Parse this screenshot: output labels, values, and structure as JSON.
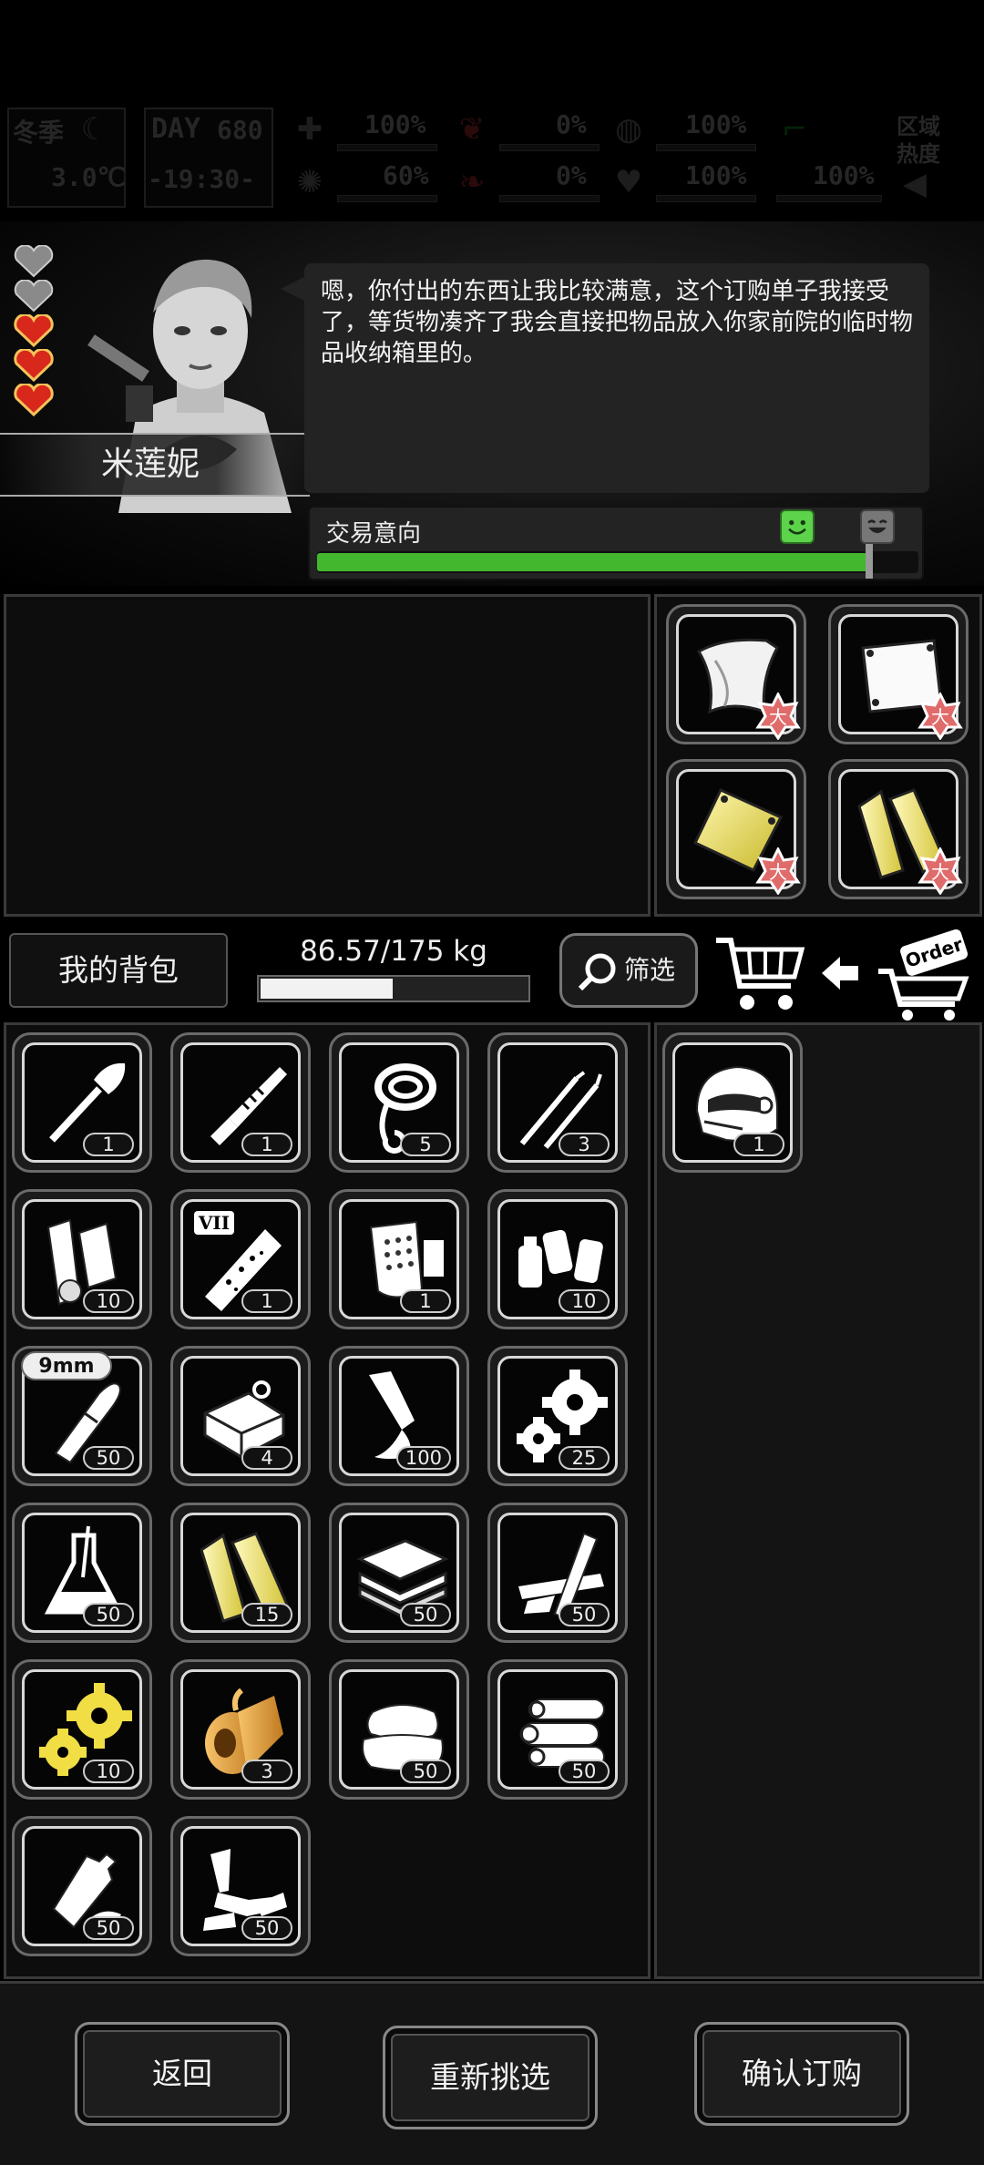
{
  "status": {
    "season": "冬季",
    "day_label": "DAY",
    "day": "680",
    "temperature": "3.0℃",
    "time": "-19:30-",
    "stats": [
      {
        "name": "health",
        "value": "100%"
      },
      {
        "name": "sanity",
        "value": "60%"
      },
      {
        "name": "bleeding",
        "value": "0%"
      },
      {
        "name": "blood",
        "value": "0%"
      },
      {
        "name": "hunger",
        "value": "100%"
      },
      {
        "name": "mood",
        "value": "100%"
      },
      {
        "name": "stamina",
        "value": "100%"
      }
    ],
    "area_label": "区域热度"
  },
  "npc": {
    "name": "米莲妮",
    "hearts_filled": 3,
    "hearts_total": 5,
    "dialog": "嗯，你付出的东西让我比较满意，这个订购单子我接受了，等货物凑齐了我会直接把物品放入你家前院的临时物品收纳箱里的。",
    "trade_label": "交易意向",
    "trade_intent": 0.92
  },
  "order_items": [
    {
      "icon": "cloth-icon",
      "size": "大"
    },
    {
      "icon": "metal-sheet-icon",
      "size": "大"
    },
    {
      "icon": "gold-plate-icon",
      "size": "大"
    },
    {
      "icon": "wood-planks-icon",
      "size": "大"
    }
  ],
  "bag": {
    "label": "我的背包",
    "weight_text": "86.57/175 kg",
    "weight_fraction": 0.495,
    "filter_label": "筛选",
    "order_badge": "Order"
  },
  "inventory": [
    {
      "icon": "shovel-icon",
      "qty": "1"
    },
    {
      "icon": "saw-knife-icon",
      "qty": "1"
    },
    {
      "icon": "rope-icon",
      "qty": "5"
    },
    {
      "icon": "lockpick-icon",
      "qty": "3"
    },
    {
      "icon": "paper-roll-icon",
      "qty": "10"
    },
    {
      "icon": "vial-icon",
      "qty": "1",
      "tag": "VII"
    },
    {
      "icon": "filter-mask-icon",
      "qty": "1"
    },
    {
      "icon": "spray-cans-icon",
      "qty": "10"
    },
    {
      "icon": "bullet-icon",
      "qty": "50",
      "caliber": "9mm"
    },
    {
      "icon": "tin-can-icon",
      "qty": "4"
    },
    {
      "icon": "glue-tube-icon",
      "qty": "100"
    },
    {
      "icon": "gears-icon",
      "qty": "25"
    },
    {
      "icon": "flask-icon",
      "qty": "50"
    },
    {
      "icon": "wood-planks-icon",
      "qty": "15"
    },
    {
      "icon": "boards-icon",
      "qty": "50"
    },
    {
      "icon": "broken-plank-icon",
      "qty": "50"
    },
    {
      "icon": "gold-gears-icon",
      "qty": "10"
    },
    {
      "icon": "tape-roll-icon",
      "qty": "3"
    },
    {
      "icon": "cloth-pile-icon",
      "qty": "50"
    },
    {
      "icon": "logs-icon",
      "qty": "50"
    },
    {
      "icon": "plastic-bottle-icon",
      "qty": "50"
    },
    {
      "icon": "scrap-metal-icon",
      "qty": "50"
    }
  ],
  "offered_items": [
    {
      "icon": "helmet-icon",
      "qty": "1"
    }
  ],
  "buttons": {
    "back": "返回",
    "reselect": "重新挑选",
    "confirm": "确认订购"
  },
  "colors": {
    "trade_bar": "#43b72e",
    "heart": "#d8281c",
    "gold_item": "#e8d85a"
  }
}
